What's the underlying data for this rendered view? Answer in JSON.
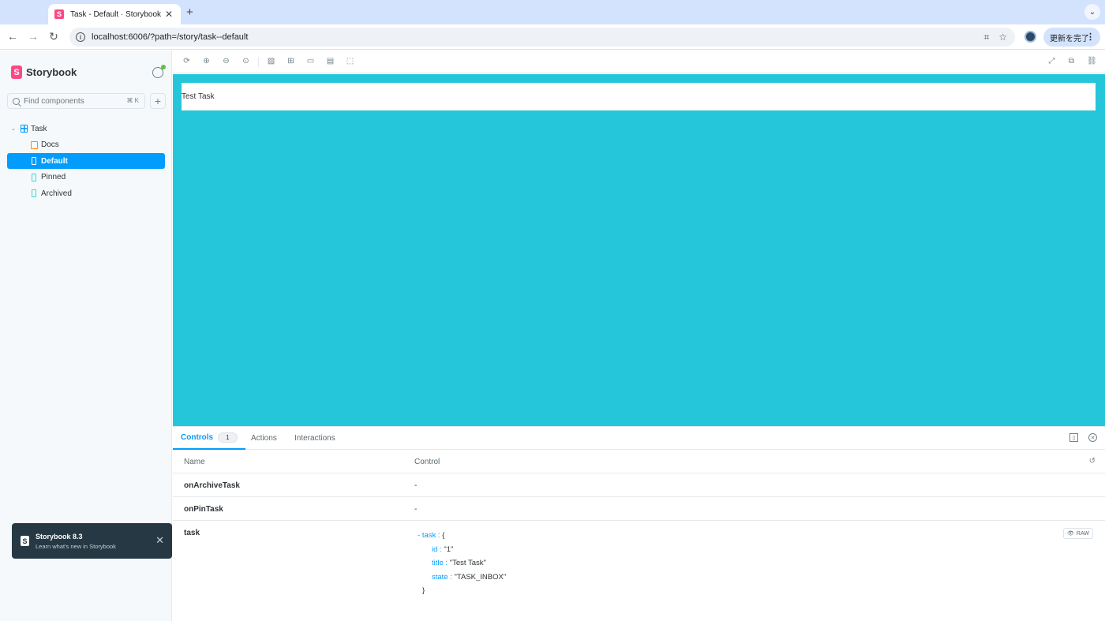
{
  "browser": {
    "tab_title": "Task - Default · Storybook",
    "url": "localhost:6006/?path=/story/task--default",
    "update_button": "更新を完了"
  },
  "sidebar": {
    "brand": "Storybook",
    "search_placeholder": "Find components",
    "search_shortcut": "⌘ K",
    "tree": {
      "component": "Task",
      "items": [
        {
          "label": "Docs",
          "kind": "docs"
        },
        {
          "label": "Default",
          "kind": "story",
          "selected": true
        },
        {
          "label": "Pinned",
          "kind": "story"
        },
        {
          "label": "Archived",
          "kind": "story"
        }
      ]
    },
    "toast": {
      "title": "Storybook 8.3",
      "subtitle": "Learn what's new in Storybook"
    }
  },
  "canvas": {
    "background": "#26c6da",
    "task_title": "Test Task"
  },
  "addons": {
    "tabs": [
      {
        "label": "Controls",
        "count": "1",
        "active": true
      },
      {
        "label": "Actions"
      },
      {
        "label": "Interactions"
      }
    ],
    "table": {
      "header_name": "Name",
      "header_control": "Control",
      "rows": [
        {
          "name": "onArchiveTask",
          "control": "-"
        },
        {
          "name": "onPinTask",
          "control": "-"
        }
      ],
      "task_row": {
        "name": "task",
        "object_key": "task",
        "fields": [
          {
            "key": "id",
            "value": "\"1\""
          },
          {
            "key": "title",
            "value": "\"Test Task\""
          },
          {
            "key": "state",
            "value": "\"TASK_INBOX\""
          }
        ],
        "raw_label": "RAW"
      }
    }
  },
  "colors": {
    "accent": "#029cfd",
    "brand": "#ff4785"
  }
}
